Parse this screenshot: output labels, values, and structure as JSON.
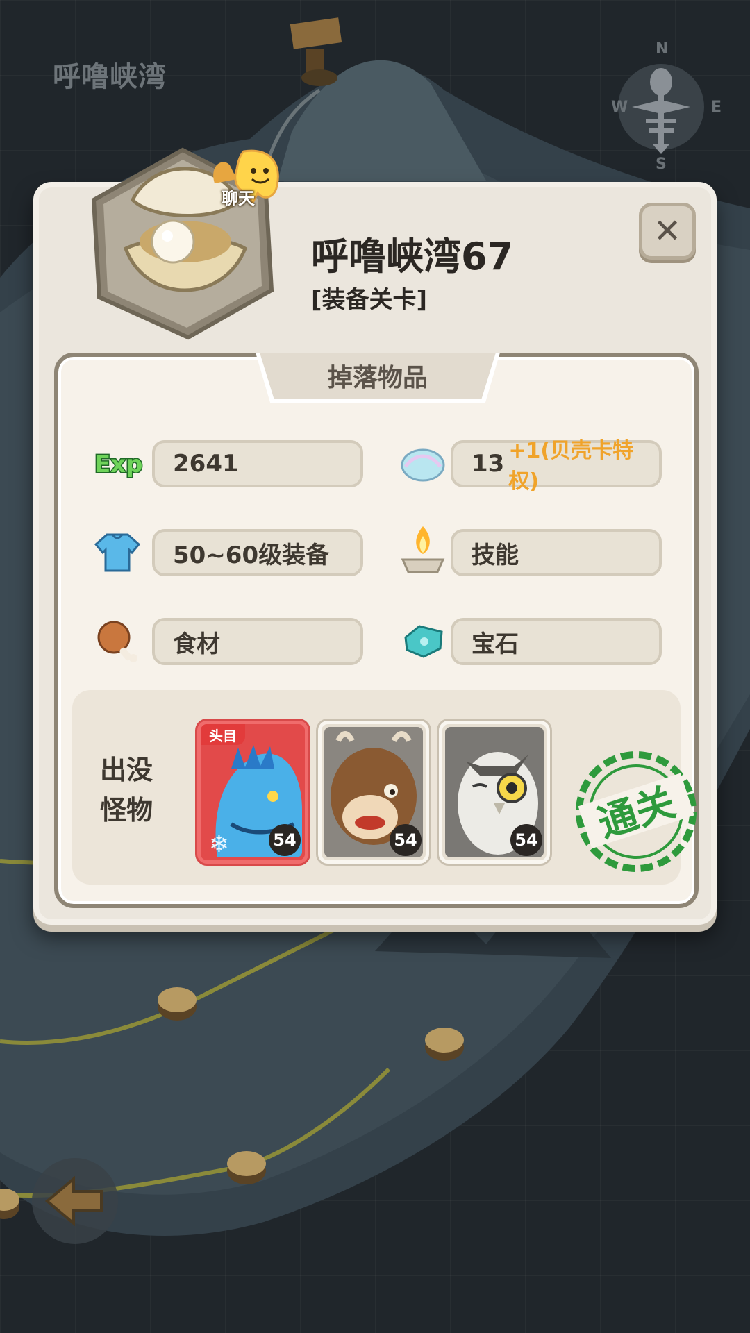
{
  "map": {
    "title": "呼噜峡湾",
    "compass": {
      "north": "N",
      "south": "S",
      "east": "E",
      "west": "W"
    }
  },
  "stage": {
    "title": "呼噜峡湾67",
    "subtitle": "[装备关卡]",
    "chat_label": "聊天",
    "cleared_stamp": "通关"
  },
  "drops": {
    "tab_label": "掉落物品",
    "items": [
      {
        "icon": "exp-icon",
        "value": "2641",
        "bonus": ""
      },
      {
        "icon": "shell-icon",
        "value": "13",
        "bonus": "+1(贝壳卡特权)"
      },
      {
        "icon": "shirt-equipment-icon",
        "value": "50~60级装备",
        "bonus": ""
      },
      {
        "icon": "campfire-skill-icon",
        "value": "技能",
        "bonus": ""
      },
      {
        "icon": "meat-ingredient-icon",
        "value": "食材",
        "bonus": ""
      },
      {
        "icon": "gem-icon",
        "value": "宝石",
        "bonus": ""
      }
    ],
    "exp_badge": "Exp"
  },
  "monsters": {
    "label_line1": "出没",
    "label_line2": "怪物",
    "list": [
      {
        "name": "ice-dragon",
        "level": "54",
        "boss": true,
        "boss_tag": "头目"
      },
      {
        "name": "yak",
        "level": "54",
        "boss": false
      },
      {
        "name": "owl",
        "level": "54",
        "boss": false
      }
    ]
  },
  "colors": {
    "panel": "#ebe6dd",
    "boss_red": "#e24a4a",
    "bonus_orange": "#f0a32a",
    "stamp_green": "#2e9a3c"
  }
}
